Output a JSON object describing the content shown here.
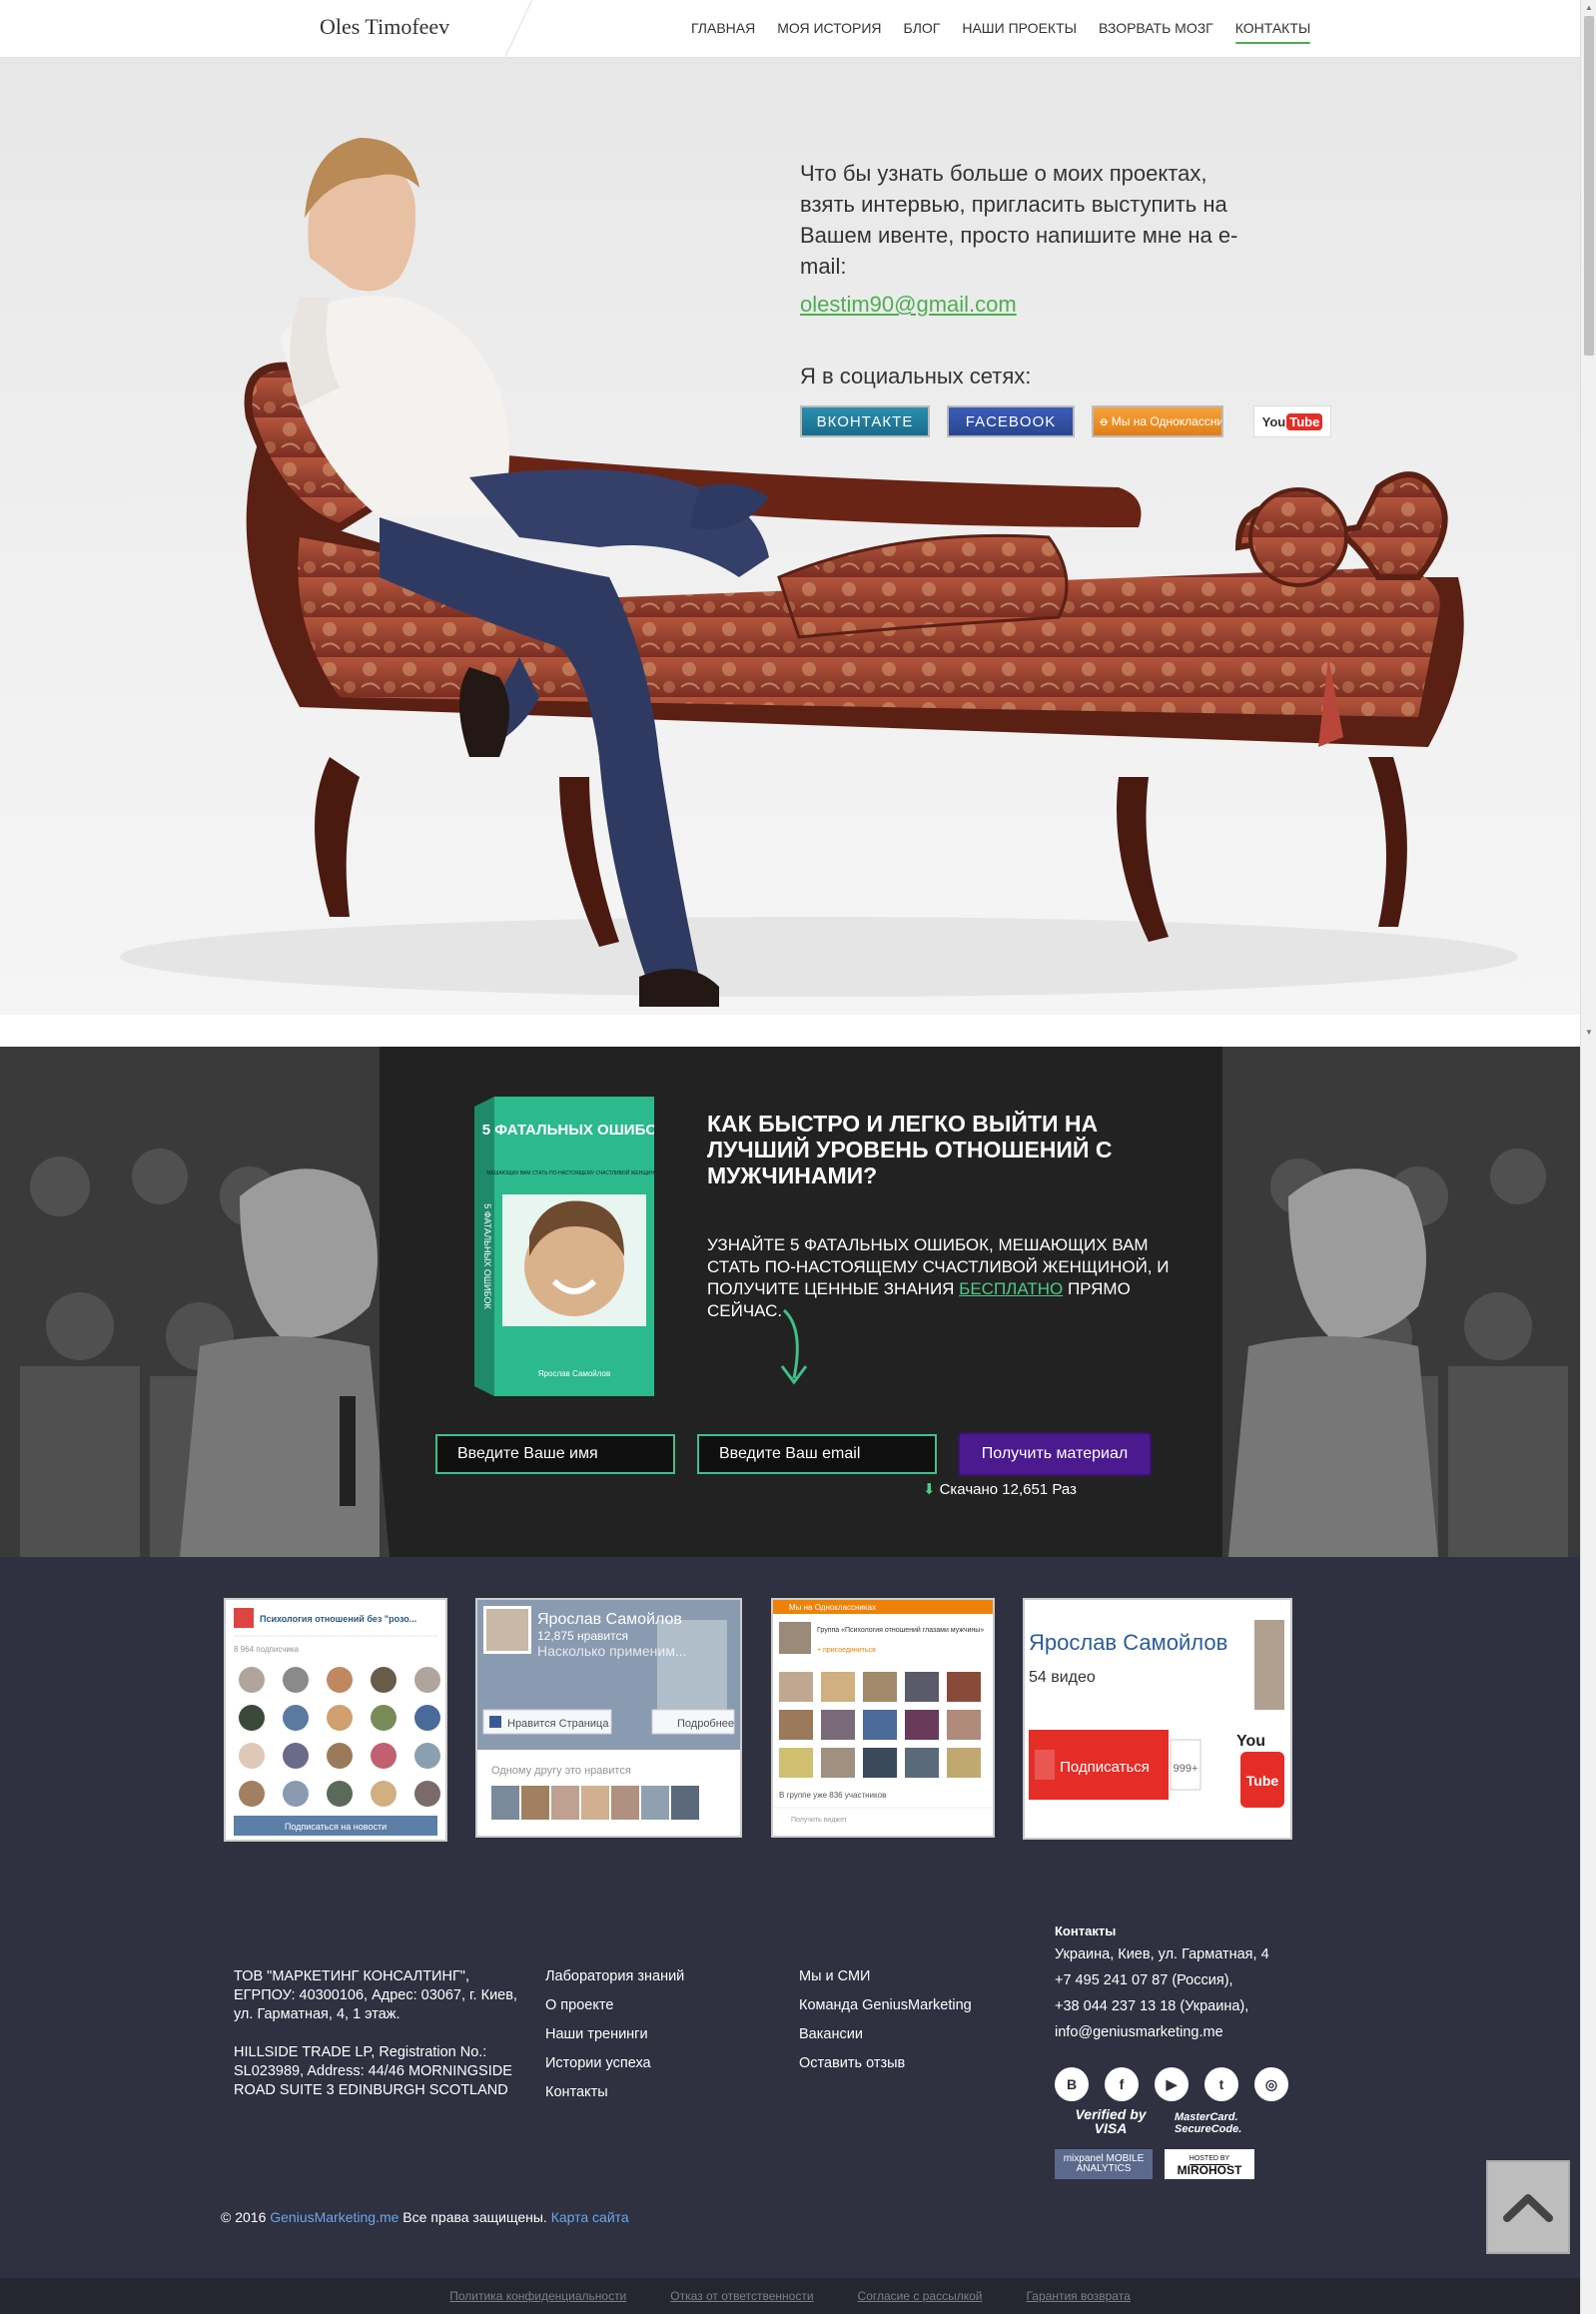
{
  "header": {
    "logo": "Oles Timofeev",
    "nav": [
      "ГЛАВНАЯ",
      "МОЯ ИСТОРИЯ",
      "БЛОГ",
      "НАШИ ПРОЕКТЫ",
      "ВЗОРВАТЬ МОЗГ",
      "КОНТАКТЫ"
    ],
    "active": "КОНТАКТЫ"
  },
  "hero": {
    "text": "Что бы узнать больше о моих проектах, взять интервью, пригласить выступить на Вашем ивенте, просто напишите мне на e-mail:",
    "email": "olestim90@gmail.com",
    "social_title": "Я в социальных сетях:",
    "social": {
      "vk": "ВКОНТАКТЕ",
      "fb": "FACEBOOK",
      "ok": "Мы на Одноклассниках",
      "yt_you": "You",
      "yt_tube": "Tube"
    }
  },
  "lead": {
    "book_title": "5 ФАТАЛЬНЫХ ОШИБОК",
    "book_subtitle": "МЕШАЮЩИХ ВАМ СТАТЬ ПО-НАСТОЯЩЕМУ СЧАСТЛИВОЙ ЖЕНЩИНОЙ",
    "book_spine": "5 ФАТАЛЬНЫХ ОШИБОК",
    "book_author": "Ярослав Самойлов",
    "title": "КАК БЫСТРО И ЛЕГКО ВЫЙТИ НА ЛУЧШИЙ УРОВЕНЬ ОТНОШЕНИЙ С МУЖЧИНАМИ?",
    "text_before": "УЗНАЙТЕ 5 ФАТАЛЬНЫХ ОШИБОК, МЕШАЮЩИХ ВАМ СТАТЬ ПО-НАСТОЯЩЕМУ СЧАСТЛИВОЙ ЖЕНЩИНОЙ, И ПОЛУЧИТЕ ЦЕННЫЕ ЗНАНИЯ ",
    "text_free": "БЕСПЛАТНО",
    "text_after": " ПРЯМО СЕЙЧАС.",
    "name_placeholder": "Введите Ваше имя",
    "email_placeholder": "Введите Ваш email",
    "button": "Получить материал",
    "downloads": "Скачано 12,651 Раз"
  },
  "widgets": {
    "vk": {
      "group": "Психология отношений без \"розо...",
      "subscribers": "8 964 подписчика",
      "button": "Подписаться на новости"
    },
    "fb": {
      "name": "Ярослав Самойлов",
      "likes": "12,875 нравится",
      "overlay": "Насколько применим...",
      "like_btn": "Нравится Страница",
      "more_btn": "Подробнее",
      "friend": "Одному другу это нравится"
    },
    "ok": {
      "header": "Мы на Одноклассниках",
      "group": "Группа «Психология отношений глазами мужчины»",
      "join": "+ присоединиться",
      "members": "В группе уже 836 участников",
      "widget": "Получить виджет"
    },
    "yt": {
      "name": "Ярослав Самойлов",
      "videos": "54 видео",
      "subscribe": "Подписаться",
      "count": "999+",
      "logo_you": "You",
      "logo_tube": "Tube"
    }
  },
  "footer": {
    "company_1": "ТОВ \"МАРКЕТИНГ КОНСАЛТИНГ\", ЕГРПОУ: 40300106, Адрес: 03067, г. Киев, ул. Гарматная, 4, 1 этаж.",
    "company_2": "HILLSIDE TRADE LP, Registration No.: SL023989, Address: 44/46 MORNINGSIDE ROAD SUITE 3 EDINBURGH SCOTLAND",
    "links_1": [
      "Лаборатория знаний",
      "О проекте",
      "Наши тренинги",
      "Истории успеха",
      "Контакты"
    ],
    "links_2": [
      "Мы и СМИ",
      "Команда GeniusMarketing",
      "Вакансии",
      "Оставить отзыв"
    ],
    "contacts_title": "Контакты",
    "contacts": [
      "Украина, Киев, ул. Гарматная, 4",
      "+7 495 241 07 87 (Россия),",
      "+38 044 237 13 18 (Украина),",
      "info@geniusmarketing.me"
    ],
    "social_icons": [
      "В",
      "f",
      "▶",
      "t",
      "◎"
    ],
    "visa": "Verified by VISA",
    "mastercard": "MasterCard. SecureCode.",
    "mixpanel": "mixpanel MOBILE ANALYTICS",
    "miro_small": "HOSTED BY",
    "miro": "MIROHOST",
    "copyright_pre": "© 2016 ",
    "copyright_link": "GeniusMarketing.me",
    "copyright_mid": " Все права защищены. ",
    "sitemap": "Карта сайта"
  },
  "bottom_links": [
    "Политика конфиденциальности",
    "Отказ от ответственности",
    "Согласие с рассылкой",
    "Гарантия возврата"
  ],
  "colors": {
    "accent_green": "#4caf50",
    "lead_button": "#4b1a8f",
    "footer_bg": "#2f3040",
    "link_blue": "#6aa7e8"
  }
}
